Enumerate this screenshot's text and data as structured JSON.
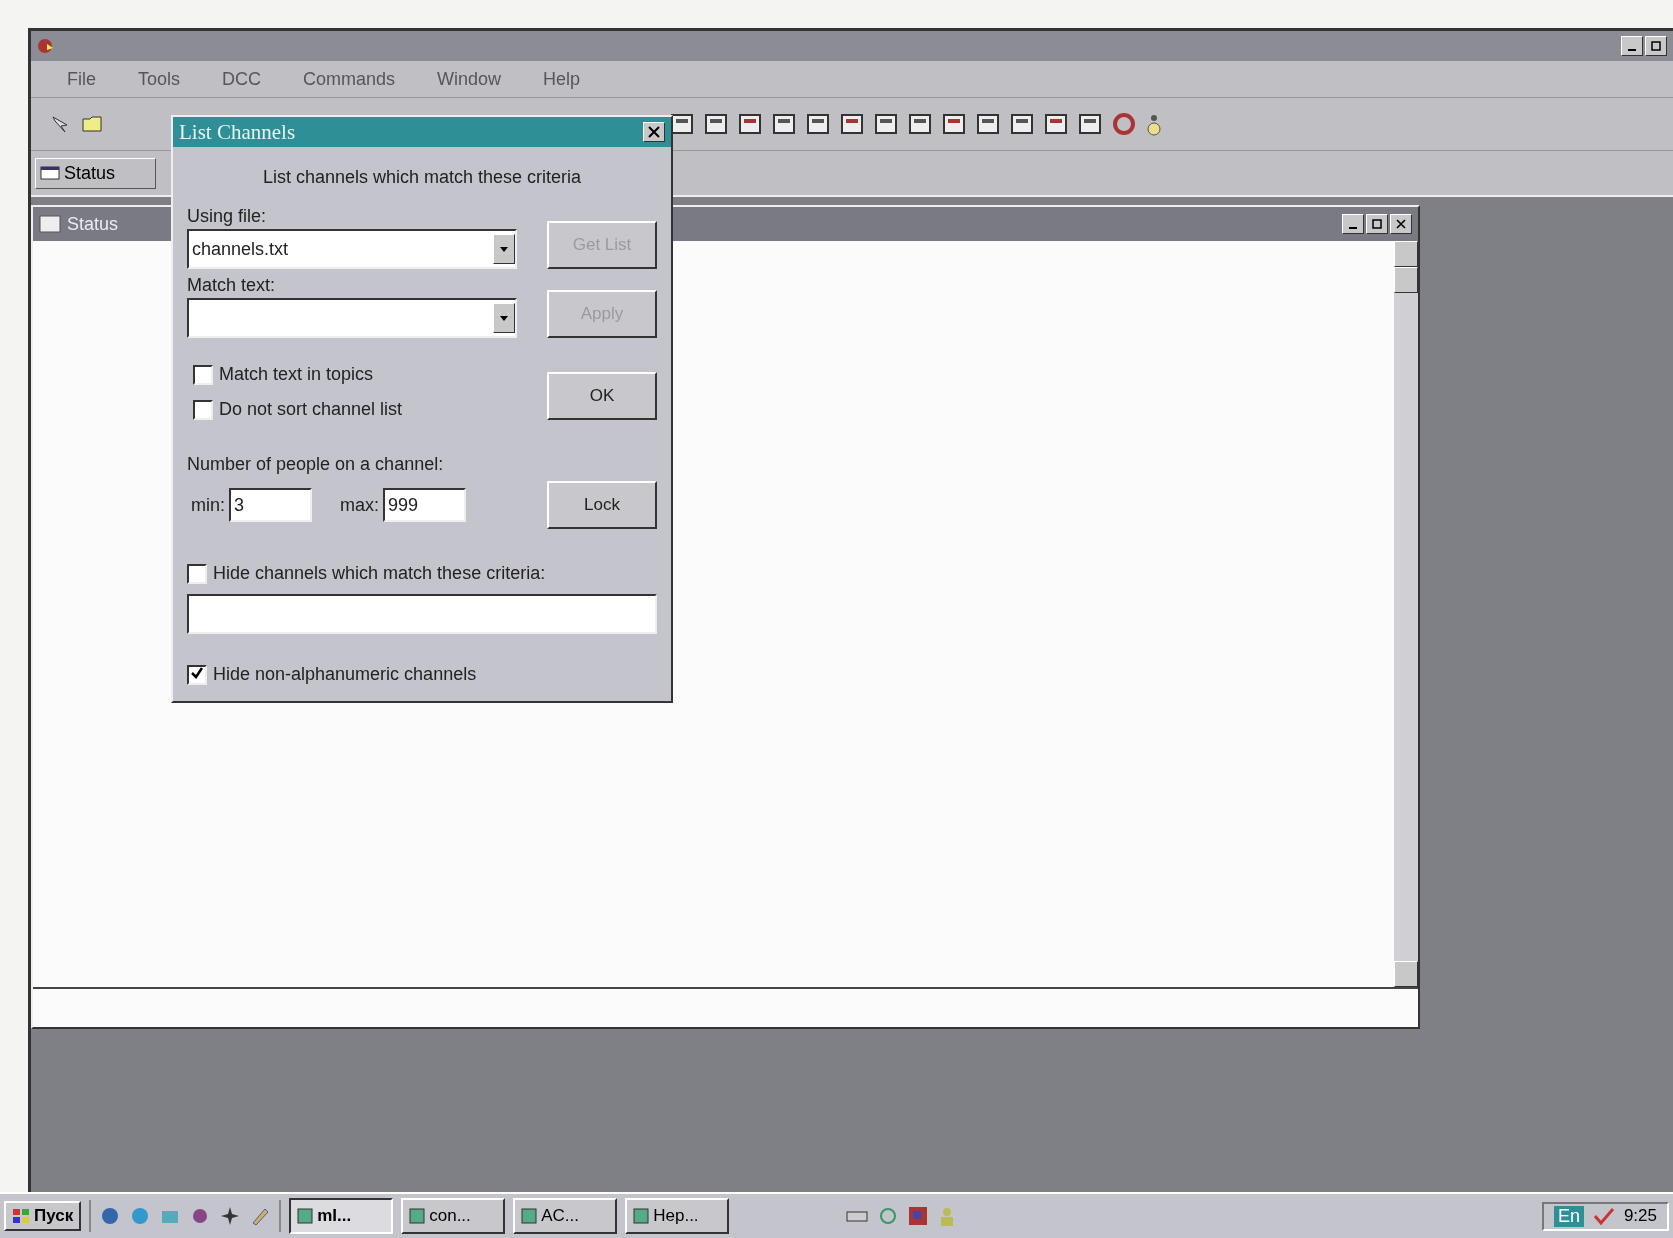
{
  "window": {
    "menu": [
      "File",
      "Tools",
      "DCC",
      "Commands",
      "Window",
      "Help"
    ]
  },
  "switchbar": {
    "tabs": [
      {
        "label": "Status",
        "selected": false
      }
    ]
  },
  "child_window": {
    "title": "Status"
  },
  "dialog": {
    "title": "List Channels",
    "heading": "List channels which match these criteria",
    "using_file": {
      "label": "Using file:",
      "value": "channels.txt"
    },
    "match_text": {
      "label": "Match text:"
    },
    "buttons": [
      {
        "label": "Get List",
        "disabled": true
      },
      {
        "label": "Apply",
        "disabled": true
      },
      {
        "label": "OK",
        "disabled": false
      },
      {
        "label": "Lock",
        "disabled": false
      }
    ],
    "options": [
      {
        "label": "Match text in topics",
        "checked": false
      },
      {
        "label": "Do not sort channel list",
        "checked": false
      }
    ],
    "people": {
      "label": "Number of people on a channel:",
      "min_label": "min:",
      "min_value": "3",
      "max_label": "max:",
      "max_value": "999"
    },
    "hide_criteria": {
      "label": "Hide channels which match these criteria:",
      "checked": false
    },
    "hide_nonalpha": {
      "label": "Hide non-alphanumeric channels",
      "checked": true
    }
  },
  "taskbar": {
    "start": "Пуск",
    "tasks": [
      {
        "label": "mI...",
        "selected": true
      },
      {
        "label": "con...",
        "selected": false
      },
      {
        "label": "AC...",
        "selected": false
      },
      {
        "label": "Нер...",
        "selected": false
      }
    ],
    "language": "En",
    "clock": "9:25"
  }
}
